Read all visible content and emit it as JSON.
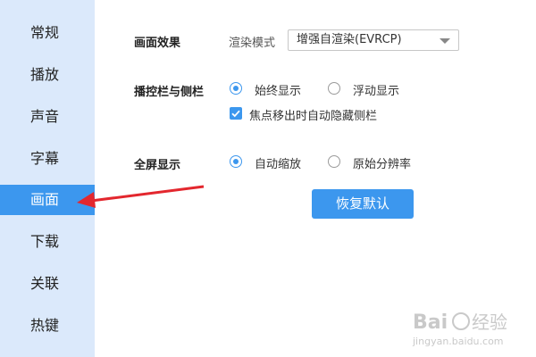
{
  "sidebar": {
    "items": [
      {
        "label": "常规"
      },
      {
        "label": "播放"
      },
      {
        "label": "声音"
      },
      {
        "label": "字幕"
      },
      {
        "label": "画面"
      },
      {
        "label": "下载"
      },
      {
        "label": "关联"
      },
      {
        "label": "热键"
      }
    ],
    "active_index": 4
  },
  "picture_effect": {
    "section_label": "画面效果",
    "render_mode_label": "渲染模式",
    "render_mode_value": "增强自渲染(EVRCP)"
  },
  "controls_sidebar": {
    "section_label": "播控栏与侧栏",
    "option_always": "始终显示",
    "option_float": "浮动显示",
    "selected": "始终显示",
    "checkbox_label": "焦点移出时自动隐藏侧栏",
    "checkbox_checked": true
  },
  "fullscreen": {
    "section_label": "全屏显示",
    "option_auto": "自动缩放",
    "option_original": "原始分辨率",
    "selected": "自动缩放"
  },
  "restore_button": {
    "label": "恢复默认"
  },
  "watermark": {
    "text": "Baidu经验",
    "subtext": "jingyan.baidu.com"
  },
  "colors": {
    "accent": "#3c97ee",
    "sidebar_bg": "#dbe9fb",
    "arrow": "#e3272e"
  }
}
